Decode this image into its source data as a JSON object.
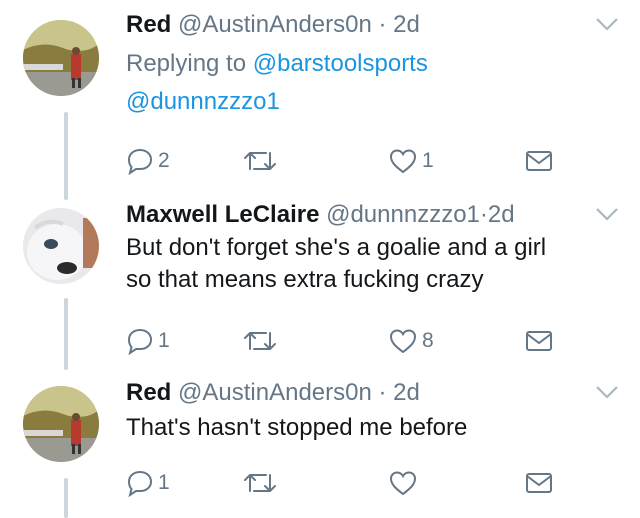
{
  "tweets": [
    {
      "name": "Red",
      "handle": "@AustinAnders0n",
      "time": "2d",
      "replying_label": "Replying to",
      "replying_to": [
        "@barstoolsports",
        "@dunnnzzzo1"
      ],
      "text": "",
      "counts": {
        "reply": "2",
        "retweet": "",
        "like": "1"
      }
    },
    {
      "name": "Maxwell LeClaire",
      "handle": "@dunnnzzzo1",
      "time": "2d",
      "text_lines": [
        "But don't forget she's a goalie and a girl",
        "so that means extra fucking crazy"
      ],
      "counts": {
        "reply": "1",
        "retweet": "",
        "like": "8"
      }
    },
    {
      "name": "Red",
      "handle": "@AustinAnders0n",
      "time": "2d",
      "text_lines": [
        "That's hasn't stopped me before"
      ],
      "counts": {
        "reply": "1",
        "retweet": "",
        "like": ""
      }
    }
  ],
  "separator": "·",
  "colors": {
    "link": "#1b95e0",
    "muted": "#657786",
    "thread_line": "#ccd6dd"
  }
}
